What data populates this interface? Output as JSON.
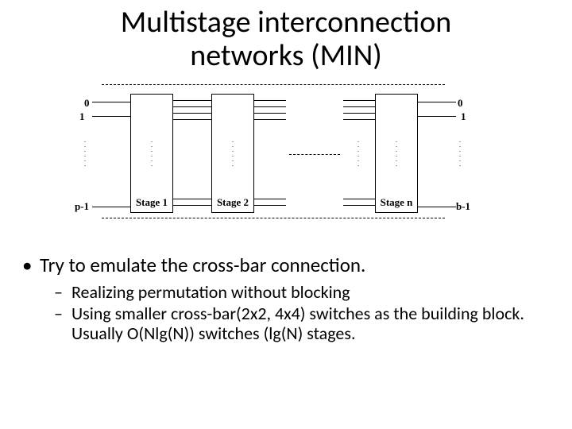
{
  "title_line1": "Multistage interconnection",
  "title_line2": "networks (MIN)",
  "bullets": {
    "b1": "Try to emulate the cross-bar connection.",
    "b2a": "Realizing permutation without blocking",
    "b2b": "Using smaller cross-bar(2x2, 4x4) switches as the building block. Usually O(Nlg(N)) switches (lg(N) stages."
  },
  "diagram": {
    "left_ports": {
      "p0": "0",
      "p1": "1",
      "plast": "p-1"
    },
    "right_ports": {
      "p0": "0",
      "p1": "1",
      "plast": "b-1"
    },
    "stages": {
      "s1": "Stage 1",
      "s2": "Stage 2",
      "sn": "Stage n"
    },
    "vdots": ".\n.\n.\n.\n.\n."
  }
}
